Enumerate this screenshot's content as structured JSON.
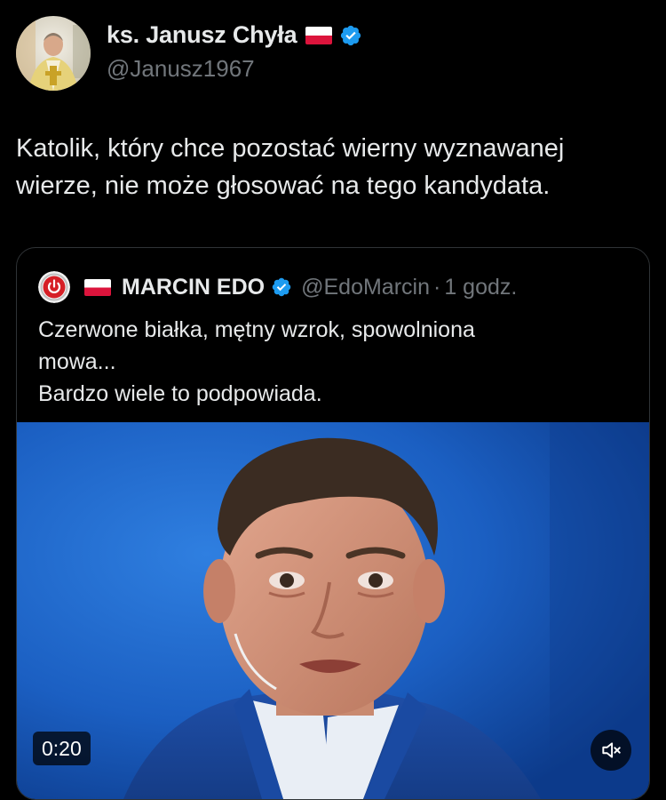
{
  "tweet": {
    "author": {
      "display_name": "ks. Janusz Chyła",
      "handle": "@Janusz1967",
      "avatar_icon": "avatar-priest-photo",
      "flag_icon": "poland-flag-icon",
      "verified_icon": "verified-badge-icon"
    },
    "text_line1": "Katolik, który chce pozostać wierny wyznawanej",
    "text_line2": "wierze, nie może głosować na tego kandydata."
  },
  "quote": {
    "author": {
      "display_name": "MARCIN EDO",
      "handle": "@EdoMarcin",
      "separator": "·",
      "time": "1 godz.",
      "avatar_icon": "power-button-avatar-icon",
      "flag_icon": "poland-flag-icon",
      "verified_icon": "verified-badge-icon"
    },
    "text_line1": "Czerwone białka, mętny wzrok, spowolniona",
    "text_line2": "mowa...",
    "text_line3": "Bardzo wiele to podpowiada.",
    "media": {
      "type": "video",
      "duration": "0:20",
      "mute_icon": "speaker-muted-icon"
    }
  },
  "colors": {
    "background": "#000000",
    "text_primary": "#e7e9ea",
    "text_secondary": "#71767b",
    "verified_blue": "#1d9bf0",
    "border": "#2f3336",
    "flag_red": "#dc143c"
  }
}
